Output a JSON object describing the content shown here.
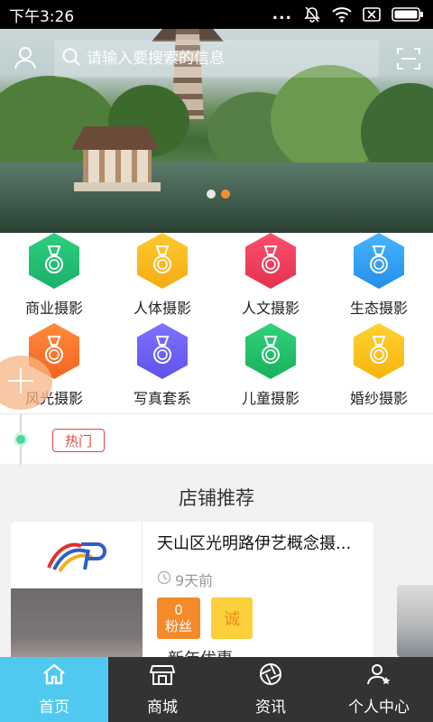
{
  "status_bar": {
    "time": "下午3:26",
    "more": "..."
  },
  "search": {
    "placeholder": "请输入要搜索的信息"
  },
  "categories": [
    {
      "label": "商业摄影",
      "icon": "medal-icon",
      "color": "#2fcf7f",
      "color2": "#19b06a"
    },
    {
      "label": "人体摄影",
      "icon": "medal-icon",
      "color": "#ffc92e",
      "color2": "#f4ac12"
    },
    {
      "label": "人文摄影",
      "icon": "medal-icon",
      "color": "#ff4f6d",
      "color2": "#e2324f"
    },
    {
      "label": "生态摄影",
      "icon": "medal-icon",
      "color": "#47b4ff",
      "color2": "#238fea"
    },
    {
      "label": "风光摄影",
      "icon": "medal-icon",
      "color": "#ff8a3a",
      "color2": "#f26522"
    },
    {
      "label": "写真套系",
      "icon": "medal-icon",
      "color": "#7e73ff",
      "color2": "#5e52ea"
    },
    {
      "label": "儿童摄影",
      "icon": "medal-icon",
      "color": "#34d07a",
      "color2": "#16b25b"
    },
    {
      "label": "婚纱摄影",
      "icon": "medal-icon",
      "color": "#ffd22e",
      "color2": "#f7b40f"
    }
  ],
  "hot_tag": "热门",
  "shop_section": {
    "title": "店铺推荐",
    "card": {
      "name": "天山区光明路伊艺概念摄...",
      "time": "9天前",
      "fans_count": "0",
      "fans_label": "粉丝",
      "honest_label": "诚",
      "extra_text": "新年优惠"
    }
  },
  "bottom_nav": [
    {
      "label": "首页",
      "icon": "home-icon",
      "active": true
    },
    {
      "label": "商城",
      "icon": "shop-icon",
      "active": false
    },
    {
      "label": "资讯",
      "icon": "aperture-icon",
      "active": false
    },
    {
      "label": "个人中心",
      "icon": "user-star-icon",
      "active": false
    }
  ],
  "colors": {
    "accent": "#4fc9f0",
    "nav_bg": "#333333",
    "hot": "#e54545",
    "fans": "#f48a28",
    "honest": "#fbd03b"
  }
}
